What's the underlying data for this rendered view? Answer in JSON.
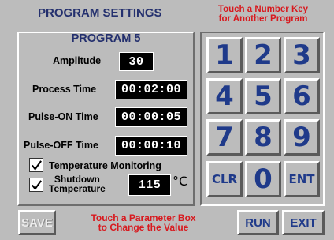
{
  "header": {
    "title": "PROGRAM SETTINGS",
    "hint_line1": "Touch a Number Key",
    "hint_line2": "for Another Program"
  },
  "program": {
    "title": "PROGRAM 5",
    "amplitude_label": "Amplitude",
    "amplitude_value": "30",
    "process_time_label": "Process Time",
    "process_time_value": "00:02:00",
    "pulse_on_label": "Pulse-ON Time",
    "pulse_on_value": "00:00:05",
    "pulse_off_label": "Pulse-OFF Time",
    "pulse_off_value": "00:00:10",
    "temp_monitoring_label": "Temperature Monitoring",
    "temp_monitoring_checked": true,
    "shutdown_label_line1": "Shutdown",
    "shutdown_label_line2": "Temperature",
    "shutdown_checked": true,
    "shutdown_value": "115",
    "shutdown_unit": "°C"
  },
  "keypad": {
    "keys": [
      "1",
      "2",
      "3",
      "4",
      "5",
      "6",
      "7",
      "8",
      "9",
      "CLR",
      "0",
      "ENT"
    ]
  },
  "footer": {
    "save_label": "SAVE",
    "hint_line1": "Touch a Parameter Box",
    "hint_line2": "to Change the Value",
    "run_label": "RUN",
    "exit_label": "EXIT"
  },
  "colors": {
    "background": "#bcbcbc",
    "title": "#24306e",
    "hint": "#d8191e",
    "key_text": "#1f3a8a"
  }
}
